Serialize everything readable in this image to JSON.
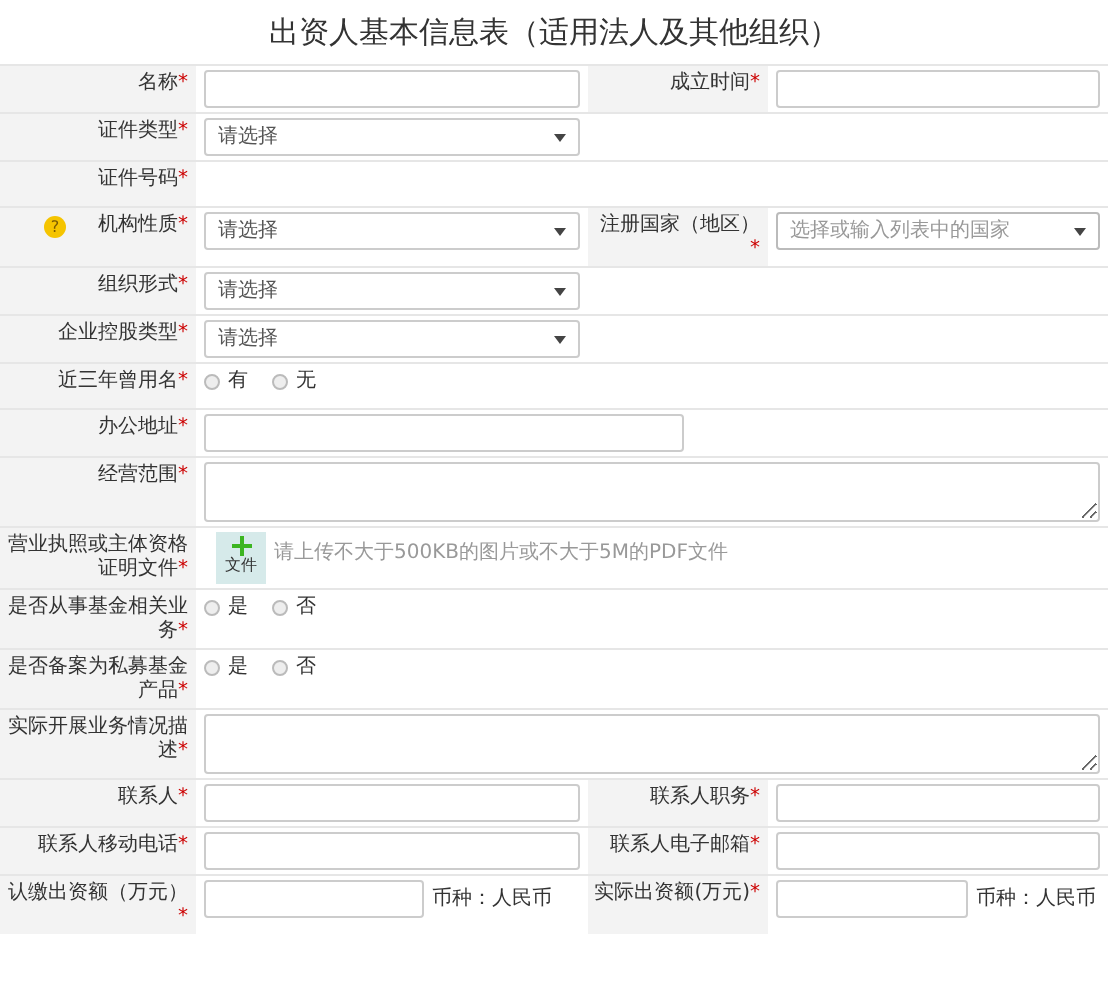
{
  "title": "出资人基本信息表（适用法人及其他组织）",
  "rows": [
    {
      "fields": [
        {
          "label": "名称",
          "mark": "*",
          "kind": "input"
        },
        {
          "label": "成立时间",
          "mark": "*",
          "kind": "input"
        }
      ]
    },
    {
      "fields": [
        {
          "label": "证件类型",
          "mark": "*",
          "kind": "select",
          "value": "请选择"
        }
      ]
    },
    {
      "fields": [
        {
          "label": "证件号码",
          "mark": "*",
          "kind": "none"
        }
      ]
    },
    {
      "fields": [
        {
          "label": "机构性质",
          "mark": "*",
          "help": "?",
          "kind": "select",
          "value": "请选择"
        },
        {
          "label": "注册国家（地区）",
          "mark": "*",
          "kind": "combo",
          "placeholder": "选择或输入列表中的国家"
        }
      ]
    },
    {
      "fields": [
        {
          "label": "组织形式",
          "mark": "*",
          "kind": "select",
          "value": "请选择"
        }
      ]
    },
    {
      "fields": [
        {
          "label": "企业控股类型",
          "mark": "*",
          "kind": "select",
          "value": "请选择"
        }
      ]
    },
    {
      "fields": [
        {
          "label": "近三年曾用名",
          "mark": "*",
          "kind": "radio",
          "options": [
            {
              "label": "有",
              "selected": false
            },
            {
              "label": "无",
              "selected": false
            }
          ]
        }
      ]
    },
    {
      "fields": [
        {
          "label": "办公地址",
          "mark": "*",
          "kind": "long-input"
        }
      ]
    },
    {
      "fields": [
        {
          "label": "经营范围",
          "mark": "*",
          "kind": "textarea"
        }
      ]
    },
    {
      "fields": [
        {
          "label": "营业执照或主体资格证明文件",
          "mark": "*",
          "kind": "upload",
          "button": "文件",
          "hint": "请上传不大于500KB的图片或不大于5M的PDF文件"
        }
      ]
    },
    {
      "fields": [
        {
          "label": "是否从事基金相关业务",
          "mark": "*",
          "kind": "radio",
          "options": [
            {
              "label": "是",
              "selected": false
            },
            {
              "label": "否",
              "selected": false
            }
          ]
        }
      ]
    },
    {
      "fields": [
        {
          "label": "是否备案为私募基金产品",
          "mark": "*",
          "kind": "radio",
          "options": [
            {
              "label": "是",
              "selected": false
            },
            {
              "label": "否",
              "selected": false
            }
          ]
        }
      ]
    },
    {
      "fields": [
        {
          "label": "实际开展业务情况描述",
          "mark": "*",
          "kind": "textarea"
        }
      ]
    },
    {
      "fields": [
        {
          "label": "联系人",
          "mark": "*",
          "kind": "input"
        },
        {
          "label": "联系人职务",
          "mark": "*",
          "kind": "input"
        }
      ]
    },
    {
      "fields": [
        {
          "label": "联系人移动电话",
          "mark": "*",
          "kind": "input"
        },
        {
          "label": "联系人电子邮箱",
          "mark": "*",
          "kind": "input"
        }
      ]
    },
    {
      "fields": [
        {
          "label": "认缴出资额（万元）",
          "mark": "*",
          "kind": "amount",
          "suffix": "币种：人民币"
        },
        {
          "label": "实际出资额(万元)",
          "mark": "*",
          "kind": "amount",
          "suffix": "币种：人民币"
        }
      ]
    }
  ]
}
